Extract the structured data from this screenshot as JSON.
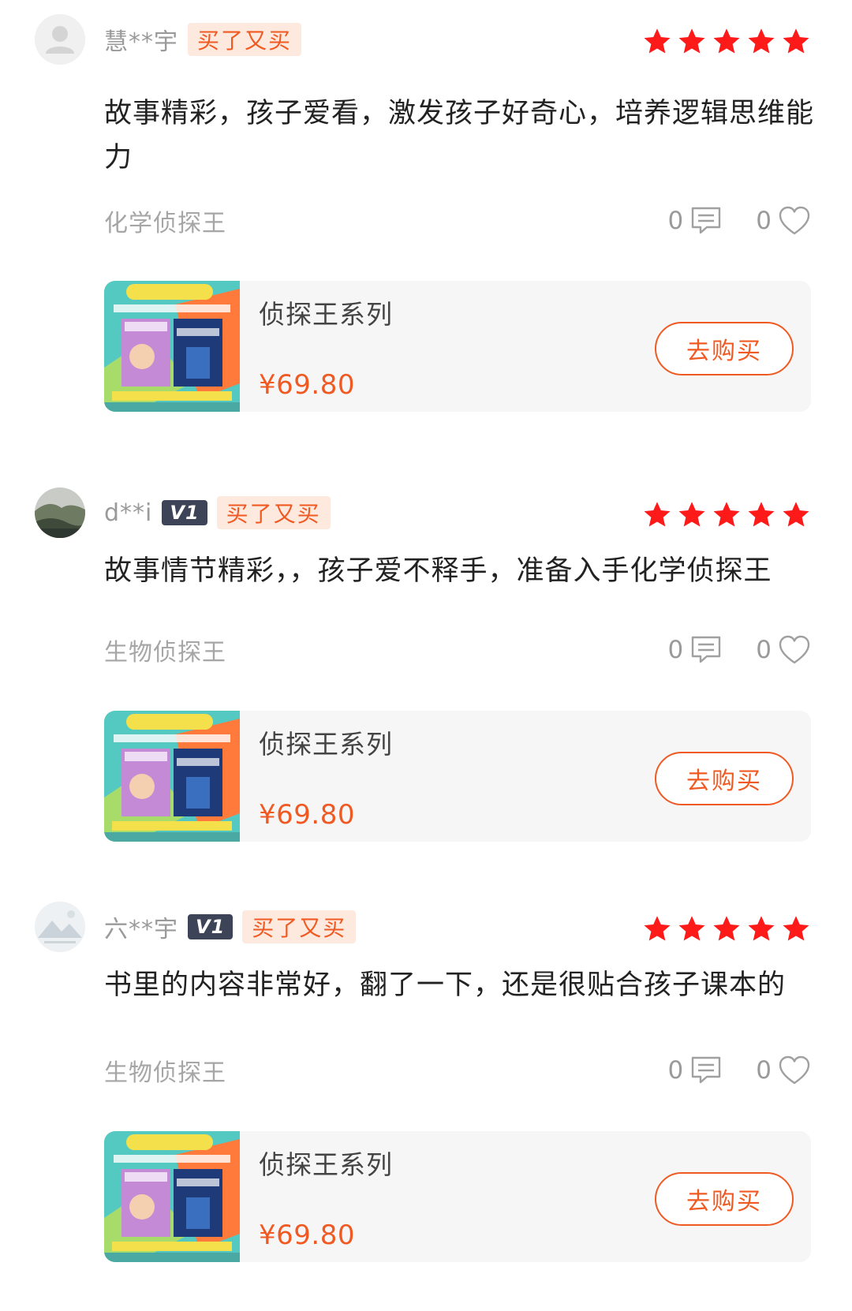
{
  "colors": {
    "accent": "#f05a22",
    "star": "#ff1a1a",
    "tag_bg": "#fde9de",
    "vip_bg": "#3d4457",
    "card_bg": "#f6f6f6",
    "muted": "#9a9a9a"
  },
  "icons": {
    "comment": "comment-icon",
    "like": "heart-icon",
    "star": "star-icon"
  },
  "reviews": [
    {
      "username": "慧**宇",
      "vip": "",
      "tag": "买了又买",
      "rating": 5,
      "text": "故事精彩，孩子爱看，激发孩子好奇心，培养逻辑思维能力",
      "product_tag": "化学侦探王",
      "comment_count": "0",
      "like_count": "0",
      "card": {
        "name": "侦探王系列",
        "price": "¥69.80",
        "button": "去购买"
      }
    },
    {
      "username": "d**i",
      "vip": "V1",
      "tag": "买了又买",
      "rating": 5,
      "text": "故事情节精彩，，孩子爱不释手，准备入手化学侦探王",
      "product_tag": "生物侦探王",
      "comment_count": "0",
      "like_count": "0",
      "card": {
        "name": "侦探王系列",
        "price": "¥69.80",
        "button": "去购买"
      }
    },
    {
      "username": "六**宇",
      "vip": "V1",
      "tag": "买了又买",
      "rating": 5,
      "text": "书里的内容非常好，翻了一下，还是很贴合孩子课本的",
      "product_tag": "生物侦探王",
      "comment_count": "0",
      "like_count": "0",
      "card": {
        "name": "侦探王系列",
        "price": "¥69.80",
        "button": "去购买"
      }
    }
  ]
}
